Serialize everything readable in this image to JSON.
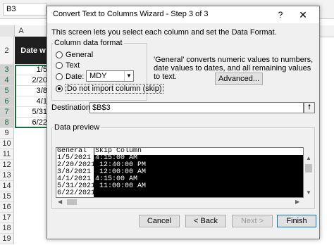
{
  "excel": {
    "name_box": "B3",
    "column_header": "A",
    "header_cell": "Date w",
    "rows": [
      {
        "num": "2",
        "value": ""
      },
      {
        "num": "3",
        "value": "1/5/"
      },
      {
        "num": "4",
        "value": "2/20/"
      },
      {
        "num": "5",
        "value": "3/8/"
      },
      {
        "num": "6",
        "value": "4/1/"
      },
      {
        "num": "7",
        "value": "5/31/"
      },
      {
        "num": "8",
        "value": "6/22/"
      },
      {
        "num": "9",
        "value": ""
      },
      {
        "num": "10",
        "value": ""
      },
      {
        "num": "11",
        "value": ""
      },
      {
        "num": "12",
        "value": ""
      },
      {
        "num": "13",
        "value": ""
      },
      {
        "num": "14",
        "value": ""
      },
      {
        "num": "15",
        "value": ""
      },
      {
        "num": "16",
        "value": ""
      },
      {
        "num": "17",
        "value": ""
      },
      {
        "num": "18",
        "value": ""
      },
      {
        "num": "19",
        "value": ""
      }
    ]
  },
  "dialog": {
    "title": "Convert Text to Columns Wizard - Step 3 of 3",
    "help_glyph": "?",
    "close_glyph": "✕",
    "intro": "This screen lets you select each column and set the Data Format.",
    "column_format_legend": "Column data format",
    "options": [
      {
        "label": "General",
        "checked": false
      },
      {
        "label": "Text",
        "checked": false
      },
      {
        "label": "Date:",
        "checked": false
      },
      {
        "label": "Do not import column (skip)",
        "checked": true
      }
    ],
    "date_format": "MDY",
    "info_text": "'General' converts numeric values to numbers, date values to dates, and all remaining values to text.",
    "advanced_button": "Advanced...",
    "destination_label": "Destination:",
    "destination_value": "$B$3",
    "preview_legend": "Data preview",
    "preview_headers": [
      "General",
      "Skip Column"
    ],
    "preview_rows": [
      [
        "1/5/2021",
        "4:15:00 AM"
      ],
      [
        "2/20/2021",
        " 12:40:00 PM"
      ],
      [
        "3/8/2021",
        " 12:00:00 AM"
      ],
      [
        "4/1/2021",
        "4:15:00 AM"
      ],
      [
        "5/31/2021",
        " 11:00:00 AM"
      ],
      [
        "6/22/2021",
        ""
      ]
    ],
    "buttons": {
      "cancel": "Cancel",
      "back": "< Back",
      "next": "Next >",
      "finish": "Finish"
    }
  }
}
